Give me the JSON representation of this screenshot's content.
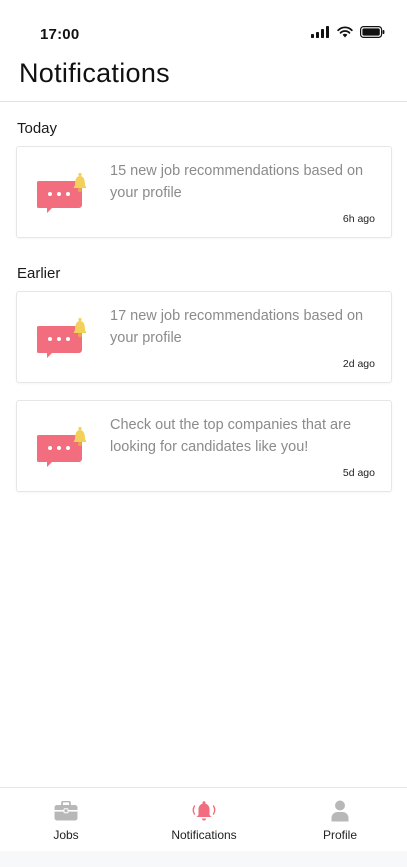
{
  "status_bar": {
    "time": "17:00"
  },
  "header": {
    "title": "Notifications"
  },
  "sections": [
    {
      "label": "Today"
    },
    {
      "label": "Earlier"
    }
  ],
  "notifications": [
    {
      "text": "15 new job recommendations based on your profile",
      "time": "6h ago",
      "icon": "chat-bell-icon"
    },
    {
      "text": "17 new job recommendations based on your profile",
      "time": "2d ago",
      "icon": "chat-bell-icon"
    },
    {
      "text": "Check out the top companies that are looking for candidates like you!",
      "time": "5d ago",
      "icon": "chat-bell-icon"
    }
  ],
  "bottom_nav": {
    "items": [
      {
        "label": "Jobs",
        "icon": "briefcase-icon",
        "active": false
      },
      {
        "label": "Notifications",
        "icon": "bell-icon",
        "active": true
      },
      {
        "label": "Profile",
        "icon": "person-icon",
        "active": false
      }
    ]
  },
  "colors": {
    "accent": "#f26d7d",
    "bell": "#f2d15a",
    "inactive_icon": "#b8b8b8",
    "muted_text": "#8b8b8b"
  }
}
